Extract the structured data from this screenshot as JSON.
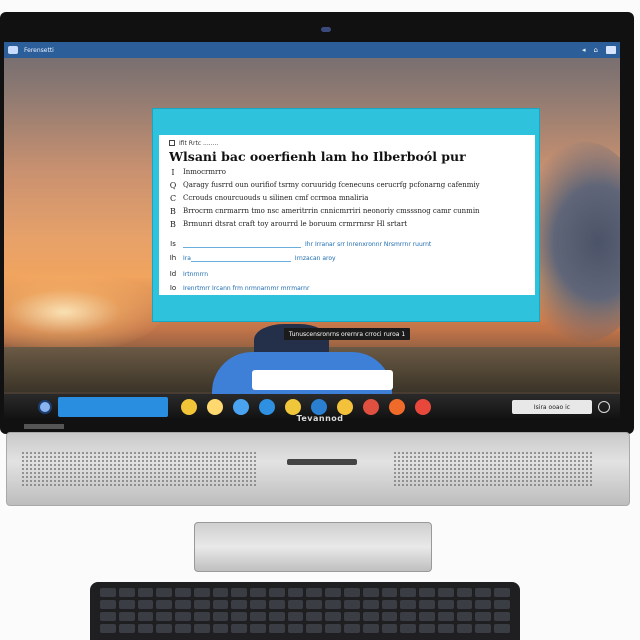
{
  "device": {
    "brand_label": "Tevannod"
  },
  "os_topbar": {
    "title": "Ferensetti",
    "tray_items": [
      "◂",
      "⌂",
      "▣"
    ]
  },
  "dialog": {
    "header_text": "Ifit  Rrtc  ........",
    "title": "Wlsani bac ooerfienh lam ho Ilberboól pur",
    "questions": [
      {
        "icon": "I",
        "text": "Inmocrmrro"
      },
      {
        "icon": "Q",
        "text": "Qaragy fusrrd oun ourifiof tsrmy coruuridg fcenecuns cerucrfg pcfonarng cafenmiy"
      },
      {
        "icon": "C",
        "text": "Ccrouds cnourcuouds u silinen cmf ccrmoa mnaliria"
      },
      {
        "icon": "B",
        "text": "Brrocrm cnrmarrn tmo nsc ameritrrin cnnicmrriri neonoriy cmsssnog camr cunmin"
      },
      {
        "icon": "B",
        "text": "Brmunri dtsrat craft toy arourrd le boruum crmrrnrsr Hl srtart"
      }
    ],
    "options": [
      {
        "mark": "Is",
        "label": "",
        "right": "Ihr Irranar srr Inrenxronnr Nrsmrrnr ruurnt",
        "input_width": 118
      },
      {
        "mark": "Ih",
        "label": "Ira",
        "right": "Irnzacan aroy",
        "input_width": 100
      },
      {
        "mark": "Id",
        "label": "Irtnrnrrn",
        "right": "",
        "input_width": 0
      },
      {
        "mark": "Io",
        "label": "Irenrtmrr  Ircann frm nrmnarnmr mrrmarnr",
        "right": "",
        "input_width": 0
      }
    ],
    "button_label": "Tunuscensronrns orernra crroci ruroa 1"
  },
  "taskbar": {
    "tray_text": "Isira ooao  ic",
    "apps": [
      {
        "name": "folder-app-icon",
        "color": "#f2c438"
      },
      {
        "name": "files-app-icon",
        "color": "#ffd970"
      },
      {
        "name": "browser-app-icon",
        "color": "#4aa3f0"
      },
      {
        "name": "edge-app-icon",
        "color": "#2f8fe0"
      },
      {
        "name": "chrome-app-icon",
        "color": "#f0c63a"
      },
      {
        "name": "store-app-icon",
        "color": "#2a7fd0"
      },
      {
        "name": "mail-app-icon",
        "color": "#f4c23a"
      },
      {
        "name": "maps-app-icon",
        "color": "#e05040"
      },
      {
        "name": "office-app-icon",
        "color": "#f06a2a"
      },
      {
        "name": "chrome2-app-icon",
        "color": "#e8483c"
      }
    ]
  }
}
